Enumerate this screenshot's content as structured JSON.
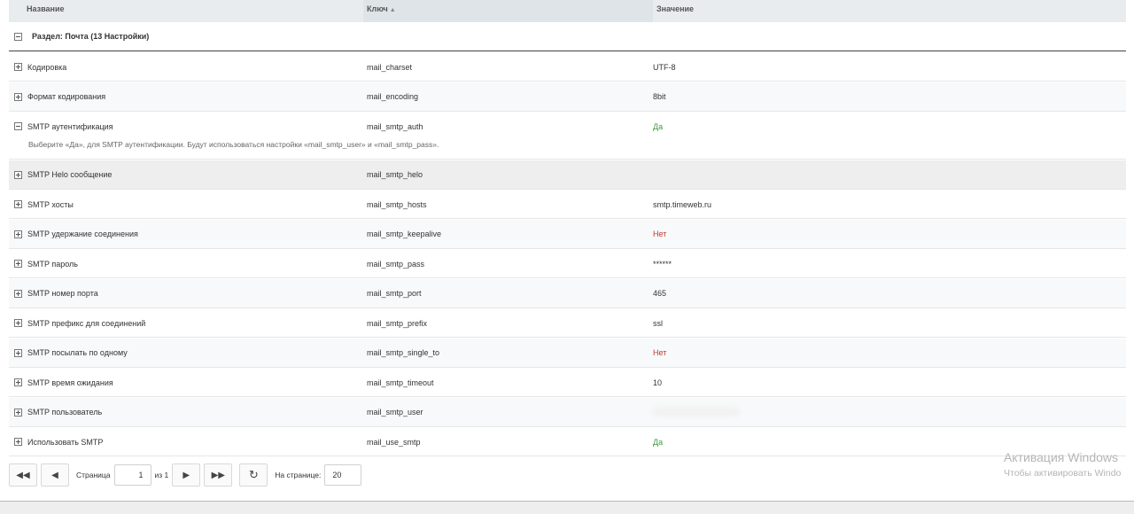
{
  "columns": {
    "name": "Название",
    "key": "Ключ",
    "value": "Значение",
    "sort_icon": "sort-asc-icon"
  },
  "group": {
    "label": "Раздел: Почта (13 Настройки)"
  },
  "rows": [
    {
      "name": "Кодировка",
      "key": "mail_charset",
      "value": "UTF-8",
      "type": "text",
      "expanded": false
    },
    {
      "name": "Формат кодирования",
      "key": "mail_encoding",
      "value": "8bit",
      "type": "text",
      "expanded": false
    },
    {
      "name": "SMTP аутентификация",
      "key": "mail_smtp_auth",
      "value": "Да",
      "type": "yes",
      "expanded": true,
      "description": "Выберите «Да», для SMTP аутентификации. Будут использоваться настройки «mail_smtp_user» и «mail_smtp_pass»."
    },
    {
      "name": "SMTP Helo сообщение",
      "key": "mail_smtp_helo",
      "value": "",
      "type": "text",
      "expanded": false
    },
    {
      "name": "SMTP хосты",
      "key": "mail_smtp_hosts",
      "value": "smtp.timeweb.ru",
      "type": "text",
      "expanded": false
    },
    {
      "name": "SMTP удержание соединения",
      "key": "mail_smtp_keepalive",
      "value": "Нет",
      "type": "no",
      "expanded": false
    },
    {
      "name": "SMTP пароль",
      "key": "mail_smtp_pass",
      "value": "******",
      "type": "text",
      "expanded": false
    },
    {
      "name": "SMTP номер порта",
      "key": "mail_smtp_port",
      "value": "465",
      "type": "text",
      "expanded": false
    },
    {
      "name": "SMTP префикс для соединений",
      "key": "mail_smtp_prefix",
      "value": "ssl",
      "type": "text",
      "expanded": false
    },
    {
      "name": "SMTP посылать по одному",
      "key": "mail_smtp_single_to",
      "value": "Нет",
      "type": "no",
      "expanded": false
    },
    {
      "name": "SMTP время ожидания",
      "key": "mail_smtp_timeout",
      "value": "10",
      "type": "text",
      "expanded": false
    },
    {
      "name": "SMTP пользователь",
      "key": "mail_smtp_user",
      "value": "",
      "type": "blurred",
      "expanded": false
    },
    {
      "name": "Использовать SMTP",
      "key": "mail_use_smtp",
      "value": "Да",
      "type": "yes",
      "expanded": false
    }
  ],
  "pager": {
    "page_label": "Страница",
    "page_value": "1",
    "of_label": "из 1",
    "per_page_label": "На странице:",
    "per_page_value": "20",
    "icons": {
      "first": "first-page-icon",
      "prev": "prev-page-icon",
      "next": "next-page-icon",
      "last": "last-page-icon",
      "refresh": "refresh-icon"
    }
  },
  "watermark": {
    "line1": "Активация Windows",
    "line2": "Чтобы активировать Windo"
  },
  "colors": {
    "yes": "#3c9a3c",
    "no": "#c0392b",
    "header_bg": "#e9ecef"
  }
}
